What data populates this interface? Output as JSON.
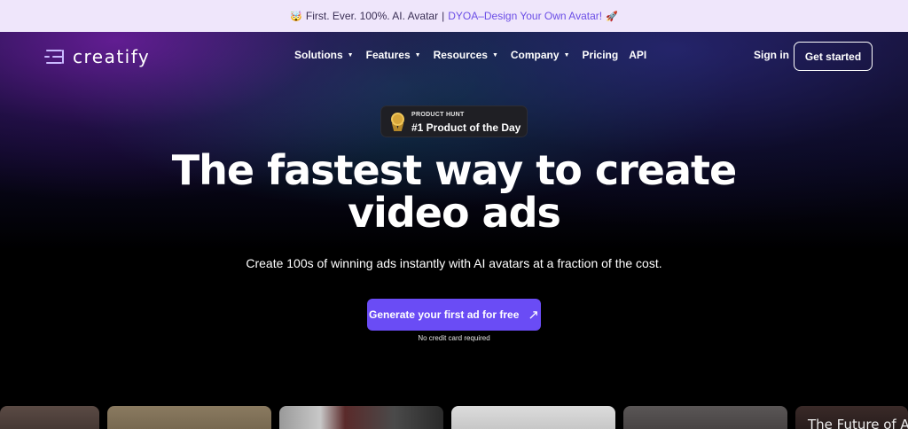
{
  "banner": {
    "emoji_left": "🤯",
    "text": "First. Ever. 100%. AI. Avatar",
    "separator": "|",
    "link_text": "DYOA–Design Your Own Avatar!",
    "emoji_right": "🚀"
  },
  "nav": {
    "logo_text": "creatify",
    "menu": [
      {
        "label": "Solutions",
        "dropdown": true
      },
      {
        "label": "Features",
        "dropdown": true
      },
      {
        "label": "Resources",
        "dropdown": true
      },
      {
        "label": "Company",
        "dropdown": true
      },
      {
        "label": "Pricing",
        "dropdown": false
      },
      {
        "label": "API",
        "dropdown": false
      }
    ],
    "caret": "▼",
    "signin_label": "Sign in",
    "get_started_label": "Get started"
  },
  "badge": {
    "small": "PRODUCT HUNT",
    "big": "#1 Product of the Day",
    "icon": "medal-icon"
  },
  "hero": {
    "headline_line1": "The fastest way to create",
    "headline_line2": "video ads",
    "subtitle": "Create 100s of winning ads instantly with AI avatars at a fraction of the cost.",
    "cta_label": "Generate your first ad for free",
    "cta_icon": "arrow-up-right-icon",
    "cta_arrow": "↗",
    "note": "No credit card required"
  },
  "thumbnails": {
    "last_text": "The Future of AI"
  },
  "colors": {
    "banner_bg": "#efe6fb",
    "banner_link": "#6b4ee6",
    "cta_bg": "#6a4cf5",
    "badge_bg": "#1f1f24"
  }
}
